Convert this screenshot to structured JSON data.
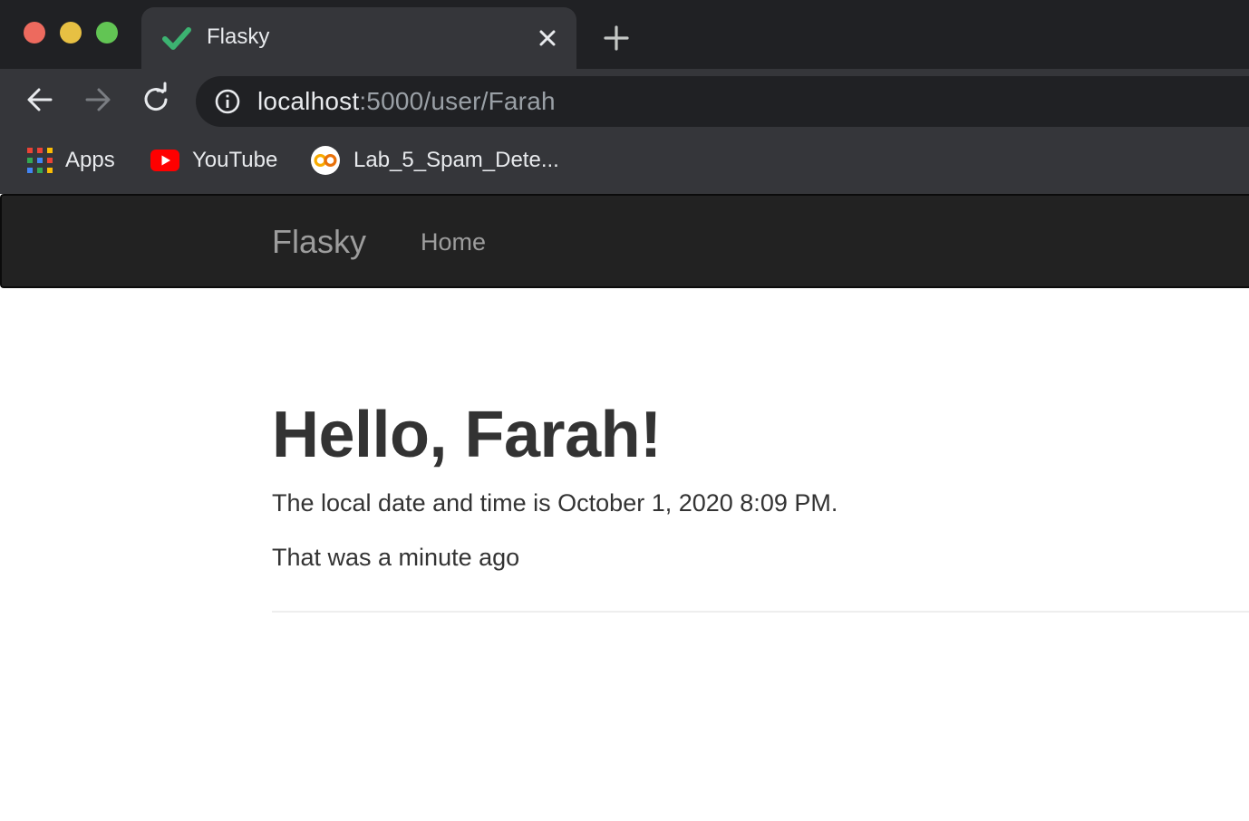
{
  "browser": {
    "tab": {
      "title": "Flasky",
      "favicon": "green-checkmark-icon"
    },
    "address": {
      "host": "localhost",
      "path": ":5000/user/Farah"
    },
    "bookmarks": [
      {
        "label": "Apps",
        "icon": "apps-grid-icon"
      },
      {
        "label": "YouTube",
        "icon": "youtube-icon"
      },
      {
        "label": "Lab_5_Spam_Dete...",
        "icon": "colab-icon"
      }
    ]
  },
  "navbar": {
    "brand": "Flasky",
    "items": [
      {
        "label": "Home"
      }
    ]
  },
  "main": {
    "greeting": "Hello, Farah!",
    "datetime": "The local date and time is October 1, 2020 8:09 PM.",
    "relative_time": "That was a minute ago"
  },
  "colors": {
    "chrome_dark": "#202124",
    "chrome_toolbar": "#35363a",
    "navbar_bg": "#222222",
    "navbar_text": "#9d9d9d",
    "body_text": "#333333"
  }
}
